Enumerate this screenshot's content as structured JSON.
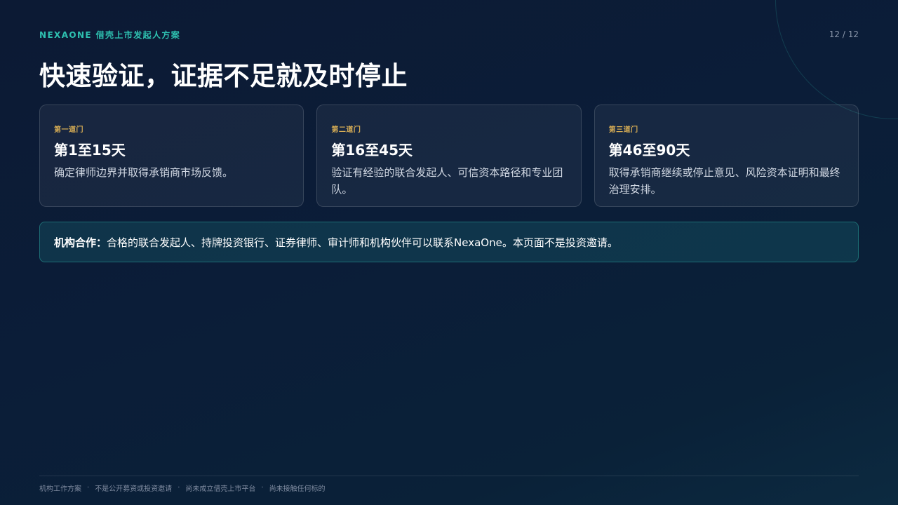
{
  "header": {
    "eyebrow": "NEXAONE 借壳上市发起人方案",
    "page_number": "12 / 12",
    "title": "快速验证，证据不足就及时停止"
  },
  "cards": [
    {
      "label": "第一道门",
      "title": "第1至15天",
      "desc": "确定律师边界并取得承销商市场反馈。"
    },
    {
      "label": "第二道门",
      "title": "第16至45天",
      "desc": "验证有经验的联合发起人、可信资本路径和专业团队。"
    },
    {
      "label": "第三道门",
      "title": "第46至90天",
      "desc": "取得承销商继续或停止意见、风险资本证明和最终治理安排。"
    }
  ],
  "note": {
    "label": "机构合作：",
    "text": "合格的联合发起人、持牌投资银行、证券律师、审计师和机构伙伴可以联系NexaOne。本页面不是投资邀请。"
  },
  "footer": {
    "items": [
      "机构工作方案",
      "不是公开募资或投资邀请",
      "尚未成立借壳上市平台",
      "尚未接触任何标的"
    ],
    "separator": "·"
  },
  "colors": {
    "accent_teal": "#2ec0b0",
    "accent_gold": "#d7ad55",
    "background": "#0b1a33"
  }
}
